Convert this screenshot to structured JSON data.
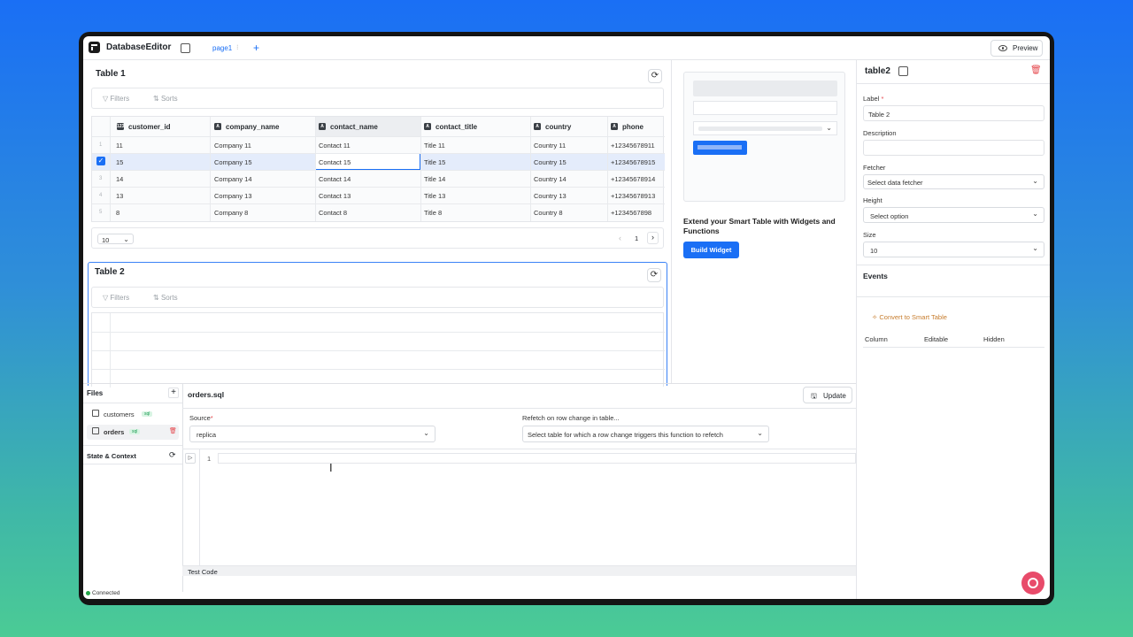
{
  "app": {
    "title": "DatabaseEditor",
    "page_tab": "page1",
    "preview_label": "Preview"
  },
  "table1": {
    "title": "Table 1",
    "filters_label": "Filters",
    "sorts_label": "Sorts",
    "columns": [
      {
        "name": "customer_id",
        "icon": "123"
      },
      {
        "name": "company_name",
        "icon": "A"
      },
      {
        "name": "contact_name",
        "icon": "A"
      },
      {
        "name": "contact_title",
        "icon": "A"
      },
      {
        "name": "country",
        "icon": "A"
      },
      {
        "name": "phone",
        "icon": "A"
      }
    ],
    "rows": [
      {
        "num": "1",
        "cells": [
          "11",
          "Company 11",
          "Contact 11",
          "Title 11",
          "Country 11",
          "+12345678911"
        ]
      },
      {
        "num": "",
        "cells": [
          "15",
          "Company 15",
          "Contact 15",
          "Title 15",
          "Country 15",
          "+12345678915"
        ]
      },
      {
        "num": "3",
        "cells": [
          "14",
          "Company 14",
          "Contact 14",
          "Title 14",
          "Country 14",
          "+12345678914"
        ]
      },
      {
        "num": "4",
        "cells": [
          "13",
          "Company 13",
          "Contact 13",
          "Title 13",
          "Country 13",
          "+12345678913"
        ]
      },
      {
        "num": "5",
        "cells": [
          "8",
          "Company 8",
          "Contact 8",
          "Title 8",
          "Country 8",
          "+1234567898"
        ]
      }
    ],
    "page_size": "10",
    "current_page": "1"
  },
  "table2": {
    "title": "Table 2",
    "filters_label": "Filters",
    "sorts_label": "Sorts"
  },
  "widget": {
    "headline": "Extend your Smart Table with Widgets and Functions",
    "button": "Build Widget"
  },
  "props": {
    "name": "table2",
    "label_label": "Label",
    "label_value": "Table 2",
    "description_label": "Description",
    "description_value": "",
    "fetcher_label": "Fetcher",
    "fetcher_value": "Select data fetcher",
    "height_label": "Height",
    "height_value": "Select option",
    "size_label": "Size",
    "size_value": "10",
    "events_label": "Events",
    "convert_label": "Convert to Smart Table",
    "col_headers": [
      "Column",
      "Editable",
      "Hidden"
    ]
  },
  "files": {
    "title": "Files",
    "items": [
      {
        "name": "customers",
        "badge": "sql"
      },
      {
        "name": "orders",
        "badge": "sql"
      }
    ],
    "state_label": "State & Context",
    "status": "Connected"
  },
  "editor": {
    "filename": "orders.sql",
    "update_label": "Update",
    "source_label": "Source",
    "source_value": "replica",
    "refetch_label": "Refetch on row change in table...",
    "refetch_value": "Select table for which a row change triggers this function to refetch",
    "line_number": "1",
    "test_code_label": "Test Code"
  },
  "colors": {
    "accent": "#1a6ff5",
    "convert": "#c77d2e",
    "danger": "#e5484d",
    "connected": "#22a447"
  }
}
